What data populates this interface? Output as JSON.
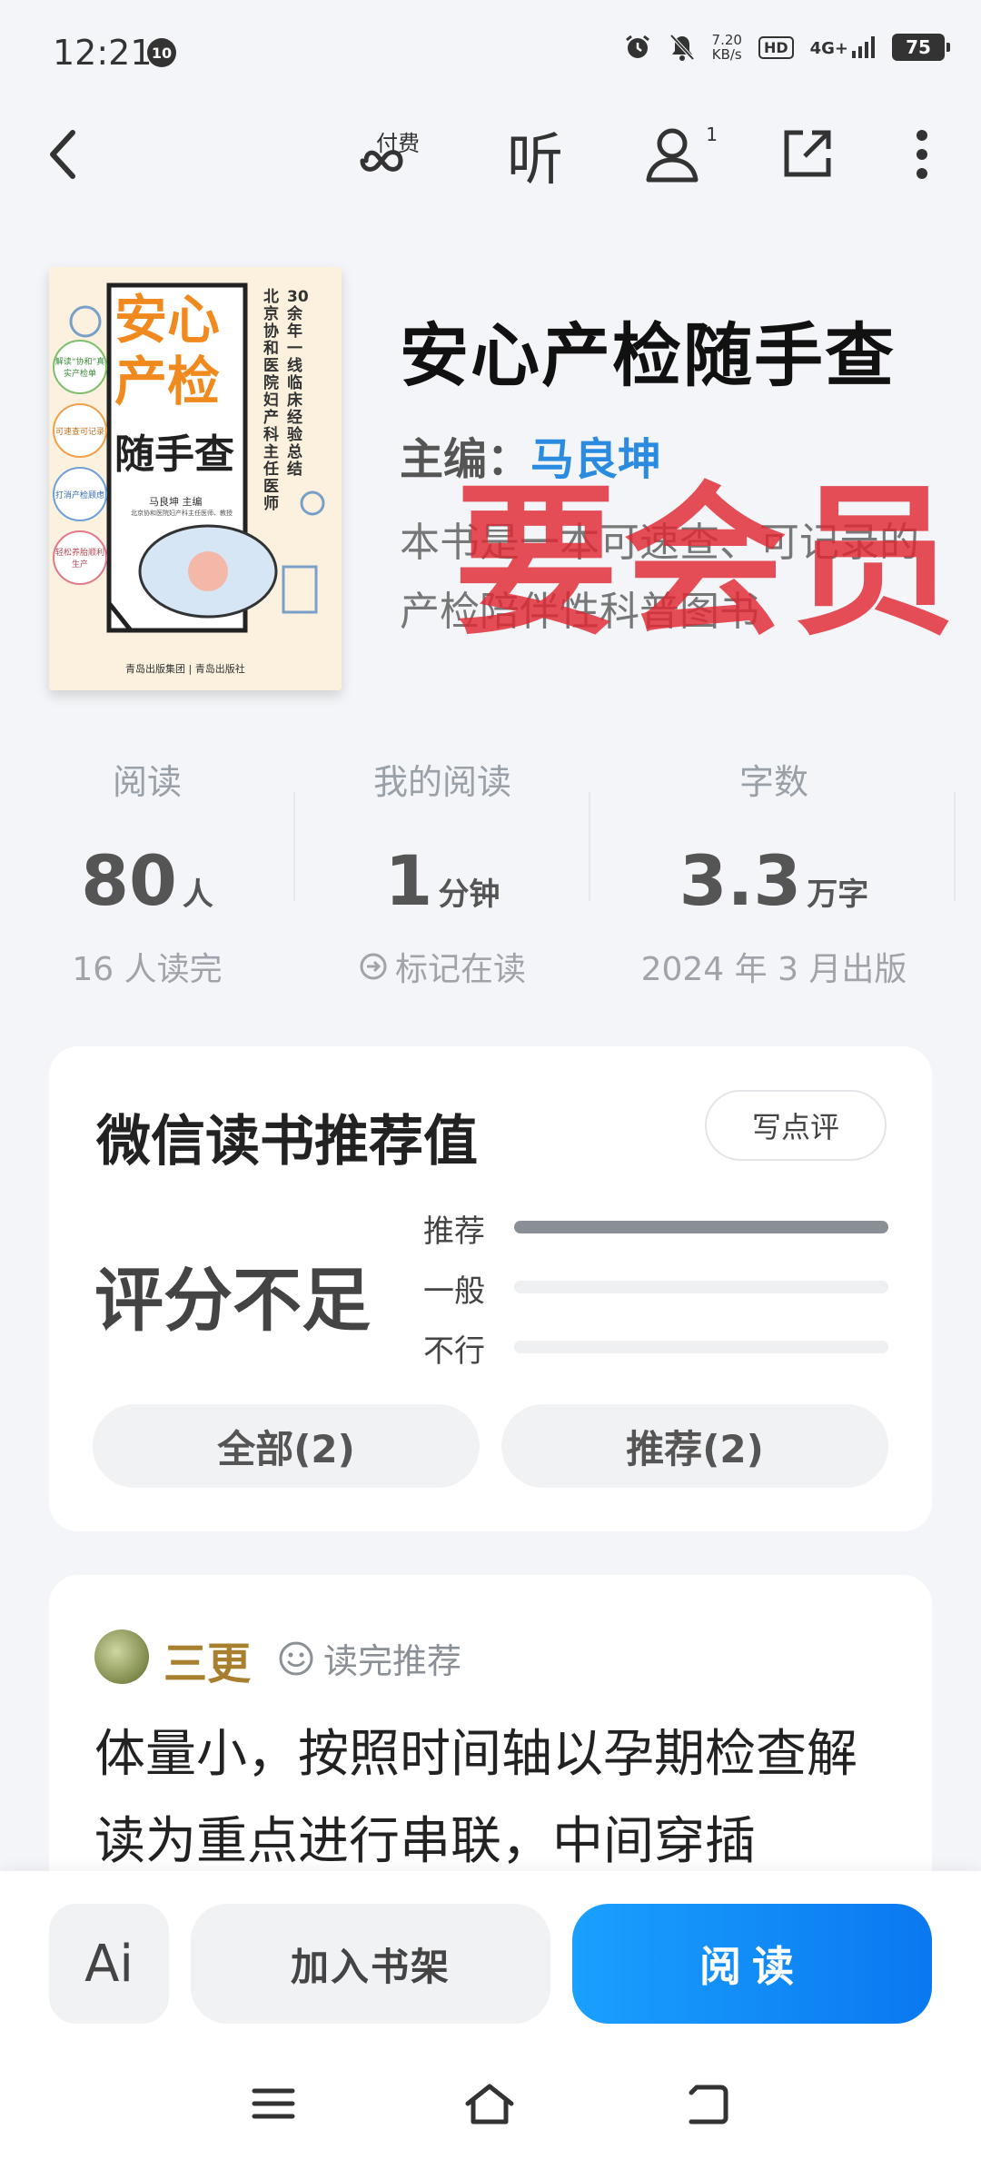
{
  "status_bar": {
    "time": "12:21",
    "notification_badge": "10",
    "net_speed": "7.20",
    "net_speed_unit": "KB/s",
    "hd": "HD",
    "network": "4G+",
    "battery": "75"
  },
  "nav": {
    "paid_label": "付费",
    "listen_label": "听",
    "friends_count": "1"
  },
  "book": {
    "title": "安心产检随手查",
    "author_prefix": "主编：",
    "author_name": "马良坤",
    "description": "本书是一本可速查、可记录的产检陪伴性科普图书",
    "overlay_stamp": "要会员",
    "cover": {
      "title_line1": "安心",
      "title_line2": "产检",
      "title_line3": "随手查",
      "vertical_line1": "北京协和医院妇产科主任医师",
      "vertical_line2": "30余年一线临床经验总结",
      "author": "马良坤 主编",
      "author_sub": "北京协和医院妇产科主任医师、教授",
      "bubble1": "解读“协和”真实产检单",
      "bubble2": "可速查可记录",
      "bubble3": "打消产检顾虑",
      "bubble4": "轻松养胎顺利生产",
      "publisher": "青岛出版集团 | 青岛出版社"
    }
  },
  "stats": [
    {
      "label": "阅读",
      "value": "80",
      "unit": "人",
      "sub": "16 人读完"
    },
    {
      "label": "我的阅读",
      "value": "1",
      "unit": "分钟",
      "sub": "标记在读"
    },
    {
      "label": "字数",
      "value": "3.3",
      "unit": "万字",
      "sub": "2024 年 3 月出版"
    }
  ],
  "rating": {
    "title": "微信读书推荐值",
    "write_review": "写点评",
    "score_text": "评分不足",
    "rows": [
      {
        "label": "推荐",
        "fraction": 1.0
      },
      {
        "label": "一般",
        "fraction": 0.0
      },
      {
        "label": "不行",
        "fraction": 0.0
      }
    ],
    "filter_all": "全部(2)",
    "filter_recommend": "推荐(2)"
  },
  "review": {
    "user": "三更",
    "tag": "读完推荐",
    "text": "体量小，按照时间轴以孕期检查解读为重点进行串联，中间穿插"
  },
  "bottom": {
    "ai_label": "Ai",
    "add_shelf": "加入书架",
    "read": "阅读"
  },
  "colors": {
    "accent_blue": "#0a78f0",
    "author_blue": "#2b8be0",
    "stamp_red": "#e12832",
    "reviewer_gold": "#a87f2f"
  }
}
